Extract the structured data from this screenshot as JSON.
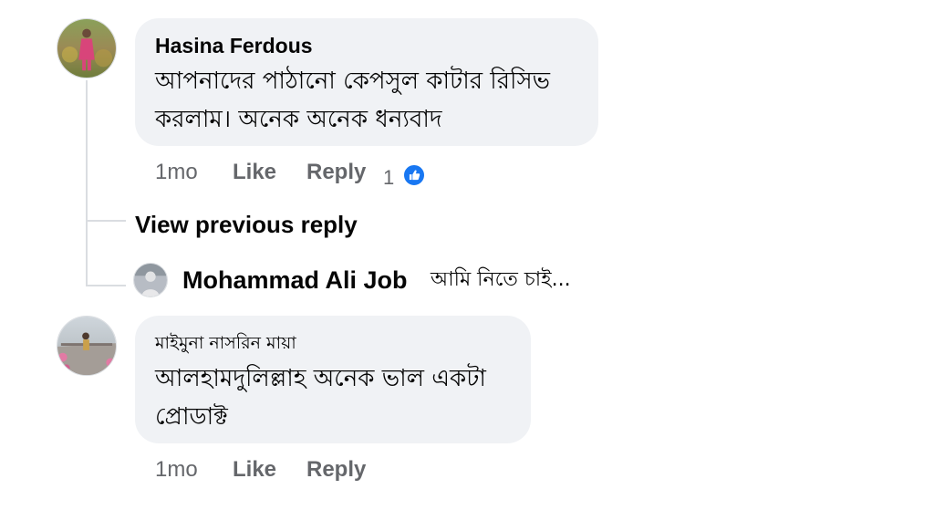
{
  "comments": [
    {
      "author": "Hasina Ferdous",
      "text_line1": "আপনাদের পাঠানো কেপসুল কাটার রিসিভ",
      "text_line2": "করলাম। অনেক অনেক ধন্যবাদ",
      "time": "1mo",
      "like_label": "Like",
      "reply_label": "Reply",
      "like_count": "1",
      "avatar_icon": "user-photo-avatar"
    },
    {
      "author": "মাইমুনা নাসরিন মায়া",
      "text_line1": "আলহামদুলিল্লাহ অনেক ভাল একটা",
      "text_line2": "প্রোডাক্ট",
      "time": "1mo",
      "like_label": "Like",
      "reply_label": "Reply",
      "avatar_icon": "user-photo-avatar"
    }
  ],
  "thread": {
    "view_previous_label": "View previous reply",
    "reply_author": "Mohammad Ali Job",
    "reply_snippet": "আমি নিতে চাই..."
  },
  "colors": {
    "bubble_bg": "#f0f2f5",
    "meta_text": "#65676b",
    "like_blue": "#1877f2",
    "thread_line": "#dadde1"
  }
}
